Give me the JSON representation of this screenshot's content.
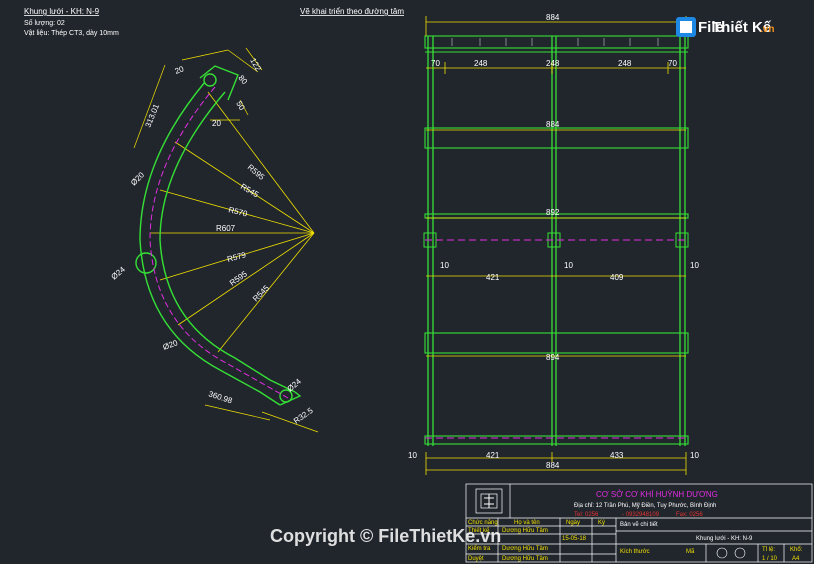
{
  "header": {
    "title": "Khung lưới - KH: N-9",
    "quantity": "Số lượng: 02",
    "material": "Vật liệu: Thép CT3, dày 10mm",
    "section_title": "Vẽ khai triển theo đường tâm"
  },
  "left_dims": {
    "d20_top1": "20",
    "d80": "80",
    "d122": "122",
    "d20_top2": "20",
    "d20_mid": "20",
    "d50": "50",
    "len_top": "313.01",
    "dia_top": "Ø20",
    "dia_left": "Ø24",
    "dia_low": "Ø20",
    "len_bottom": "360.98",
    "dia_bottom": "Ø24",
    "r_end": "R32.5",
    "radii": [
      "R595",
      "R545",
      "R570",
      "R607",
      "R579",
      "R595",
      "R545"
    ]
  },
  "right_dims": {
    "total_top": "884",
    "seg": [
      "70",
      "248",
      "248",
      "248",
      "70"
    ],
    "mid1": "884",
    "mid2": "892",
    "left10": "10",
    "c421": "421",
    "mid10": "10",
    "c409": "409",
    "right10": "10",
    "mid3": "894",
    "b10l": "10",
    "b421": "421",
    "b433": "433",
    "b10r": "10",
    "total_bottom": "884"
  },
  "title_block": {
    "company": "CƠ SỞ CƠ KHÍ HUỲNH DƯƠNG",
    "address": "Địa chỉ: 12 Trần Phú, Mỹ Điền, Tuy Phước, Bình Định",
    "tel": "Tel: 0256",
    "phone": "- 0932948109",
    "fax": "Fax: 0256",
    "col1": "Chức năng",
    "col2": "Họ và tên",
    "col3": "Ngày",
    "col4": "Ký",
    "row1_role": "Thiết kế",
    "row1_name": "Dương Hữu Tâm",
    "row1_date": "15-05-18",
    "row2_role": "Kiểm tra",
    "row2_name": "Dương Hữu Tâm",
    "row3_role": "Duyệt",
    "row3_name": "Dương Hữu Tâm",
    "drawing_type": "Bản vẽ chi tiết",
    "drawing_name": "Khung lưới - KH: N-9",
    "sizes": "Kích thước",
    "mat": "Mã",
    "ratio_label": "Tỉ lệ:",
    "ratio": "1 / 10",
    "sheet_label": "Khổ:",
    "sheet": "A4"
  },
  "watermark": {
    "logo_text": "File",
    "logo_text2": "Thiết Kế",
    "logo_domain": ".vn",
    "copyright": "Copyright © FileThietKe.vn"
  },
  "colors": {
    "background": "#21262d",
    "outline": "#35e035",
    "dimension": "#f0e000",
    "centerline": "#e12de1",
    "text": "#ffffff"
  }
}
